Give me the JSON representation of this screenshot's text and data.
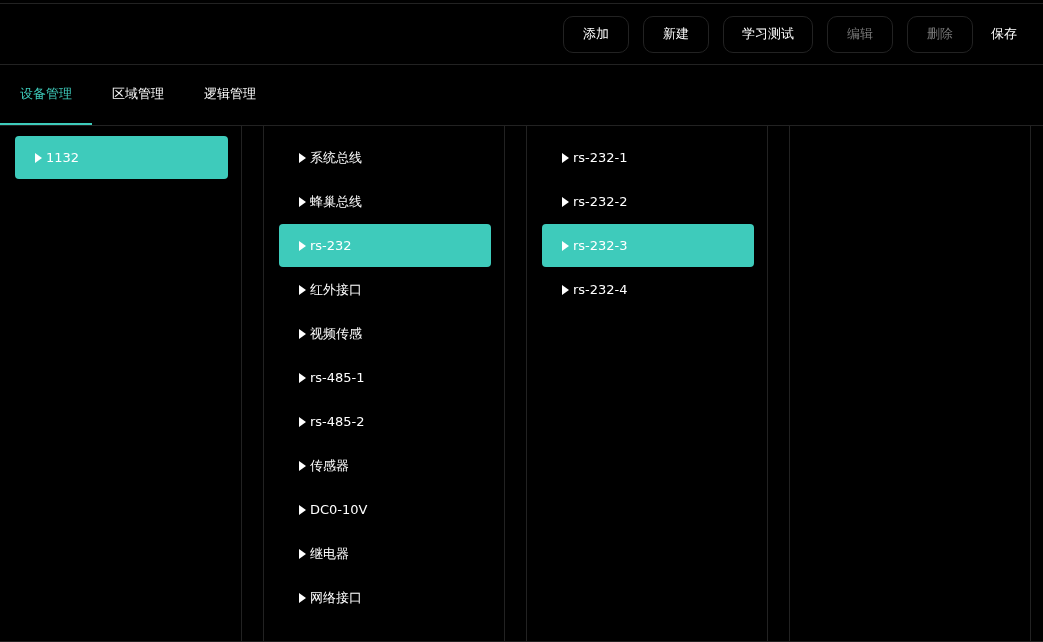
{
  "toolbar": {
    "buttons": [
      {
        "label": "添加",
        "disabled": false,
        "kind": "outlined"
      },
      {
        "label": "新建",
        "disabled": false,
        "kind": "outlined"
      },
      {
        "label": "学习测试",
        "disabled": false,
        "kind": "outlined"
      },
      {
        "label": "编辑",
        "disabled": true,
        "kind": "outlined"
      },
      {
        "label": "删除",
        "disabled": true,
        "kind": "outlined"
      },
      {
        "label": "保存",
        "disabled": false,
        "kind": "plain"
      }
    ]
  },
  "tabs": [
    {
      "label": "设备管理",
      "selected": true
    },
    {
      "label": "区域管理",
      "selected": false
    },
    {
      "label": "逻辑管理",
      "selected": false
    }
  ],
  "columns": [
    {
      "items": [
        {
          "label": "1132",
          "selected": true
        }
      ]
    },
    {
      "items": [
        {
          "label": "系统总线",
          "selected": false
        },
        {
          "label": "蜂巢总线",
          "selected": false
        },
        {
          "label": "rs-232",
          "selected": true
        },
        {
          "label": "红外接口",
          "selected": false
        },
        {
          "label": "视频传感",
          "selected": false
        },
        {
          "label": "rs-485-1",
          "selected": false
        },
        {
          "label": "rs-485-2",
          "selected": false
        },
        {
          "label": "传感器",
          "selected": false
        },
        {
          "label": "DC0-10V",
          "selected": false
        },
        {
          "label": "继电器",
          "selected": false
        },
        {
          "label": "网络接口",
          "selected": false
        }
      ]
    },
    {
      "items": [
        {
          "label": "rs-232-1",
          "selected": false
        },
        {
          "label": "rs-232-2",
          "selected": false
        },
        {
          "label": "rs-232-3",
          "selected": true
        },
        {
          "label": "rs-232-4",
          "selected": false
        }
      ]
    },
    {}
  ]
}
